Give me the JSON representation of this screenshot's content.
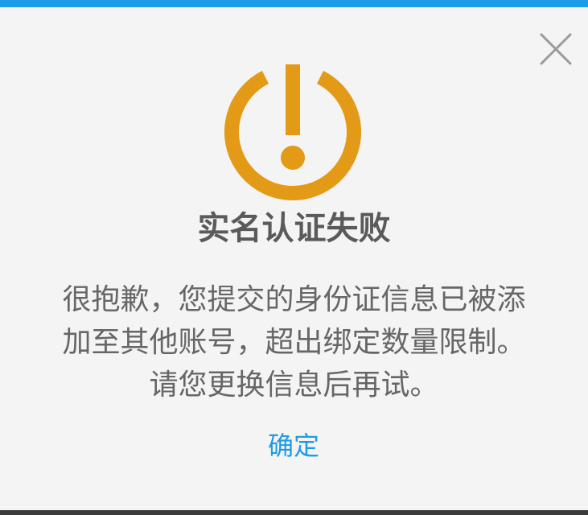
{
  "dialog": {
    "title": "实名认证失败",
    "message_lines": [
      "很抱歉，您提交的身份证信息已被添",
      "加至其他账号，超出绑定数量限制。",
      "请您更换信息后再试。"
    ],
    "confirm_label": "确定",
    "icon": "warning-power-icon",
    "close_icon": "close-icon"
  },
  "colors": {
    "accent": "#1e9be8",
    "warning": "#e39a17",
    "title_text": "#5a5a5a",
    "body_text": "#666666",
    "background": "#f4f4f4"
  }
}
